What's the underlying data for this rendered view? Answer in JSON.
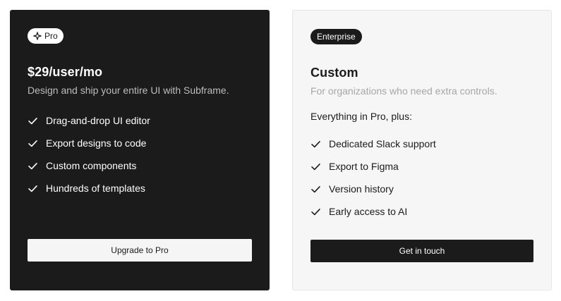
{
  "pro": {
    "badge_label": "Pro",
    "badge_icon": "sparkle-icon",
    "price": "$29/user/mo",
    "description": "Design and ship your entire UI with Subframe.",
    "features": [
      "Drag-and-drop UI editor",
      "Export designs to code",
      "Custom components",
      "Hundreds of templates"
    ],
    "cta_label": "Upgrade to Pro"
  },
  "enterprise": {
    "badge_label": "Enterprise",
    "title": "Custom",
    "description": "For organizations who need extra controls.",
    "lead": "Everything in Pro, plus:",
    "features": [
      "Dedicated Slack support",
      "Export to Figma",
      "Version history",
      "Early access to AI"
    ],
    "cta_label": "Get in touch"
  },
  "colors": {
    "dark": "#1b1b1b",
    "light_card": "#f6f6f6",
    "muted_text": "#a6a6a6"
  }
}
